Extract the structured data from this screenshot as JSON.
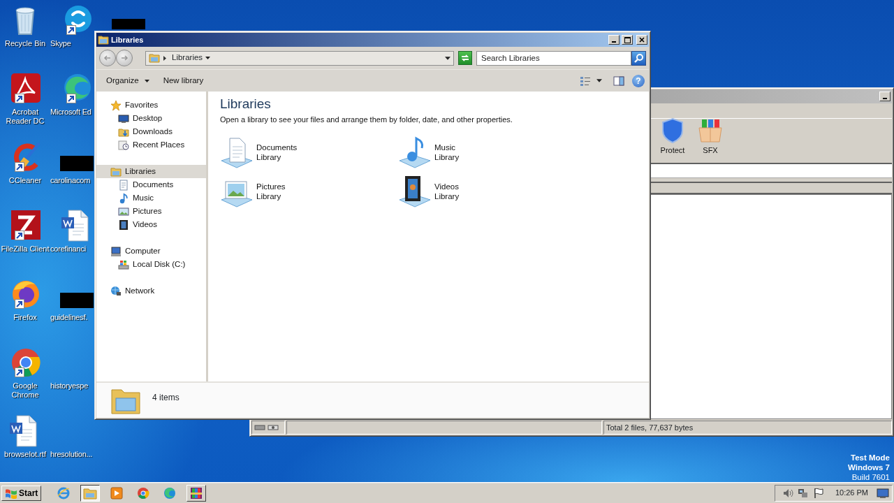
{
  "desktop_icons": [
    {
      "label": "Recycle Bin",
      "kind": "recycle-bin",
      "shortcut": false
    },
    {
      "label": "Acrobat Reader DC",
      "kind": "acrobat",
      "shortcut": true
    },
    {
      "label": "CCleaner",
      "kind": "ccleaner",
      "shortcut": true
    },
    {
      "label": "FileZilla Client",
      "kind": "filezilla",
      "shortcut": true
    },
    {
      "label": "Firefox",
      "kind": "firefox",
      "shortcut": true
    },
    {
      "label": "Google Chrome",
      "kind": "chrome",
      "shortcut": true
    },
    {
      "label": "browselot.rtf",
      "kind": "word-doc",
      "shortcut": false
    },
    {
      "label": "Skype",
      "kind": "skype",
      "shortcut": true
    },
    {
      "label": "Microsoft Ed",
      "kind": "edge",
      "shortcut": true
    },
    {
      "label": "carolinacom",
      "kind": "redacted",
      "shortcut": false
    },
    {
      "label": "corefinanci",
      "kind": "word-doc",
      "shortcut": false
    },
    {
      "label": "guidelinesf.",
      "kind": "redacted",
      "shortcut": false
    },
    {
      "label": "historyespe",
      "kind": "blank"
    },
    {
      "label": "hresolution...",
      "kind": "blank"
    },
    {
      "kind": "redacted",
      "shortcut": false
    }
  ],
  "archive_window": {
    "toolbar": [
      {
        "label": "Protect",
        "kind": "shield"
      },
      {
        "label": "SFX",
        "kind": "box"
      }
    ],
    "status_bar": "Total 2 files, 77,637 bytes"
  },
  "explorer": {
    "title": "Libraries",
    "breadcrumb": [
      "Libraries"
    ],
    "search": {
      "placeholder": "Search Libraries"
    },
    "commands": [
      {
        "label": "Organize",
        "dropdown": true
      },
      {
        "label": "New library",
        "dropdown": false
      }
    ],
    "help_label": "?",
    "nav": [
      {
        "label": "Favorites",
        "kind": "star",
        "selected": false,
        "children": [
          {
            "label": "Desktop",
            "kind": "desktop",
            "selected": false
          },
          {
            "label": "Downloads",
            "kind": "downloads",
            "selected": false
          },
          {
            "label": "Recent Places",
            "kind": "recent",
            "selected": false
          }
        ]
      },
      {
        "label": "Libraries",
        "kind": "library",
        "selected": true,
        "children": [
          {
            "label": "Documents",
            "kind": "document",
            "selected": false
          },
          {
            "label": "Music",
            "kind": "music",
            "selected": false
          },
          {
            "label": "Pictures",
            "kind": "pictures",
            "selected": false
          },
          {
            "label": "Videos",
            "kind": "videos",
            "selected": false
          }
        ]
      },
      {
        "label": "Computer",
        "kind": "computer",
        "selected": false,
        "children": [
          {
            "label": "Local Disk (C:)",
            "kind": "disk",
            "selected": false
          }
        ]
      },
      {
        "label": "Network",
        "kind": "network",
        "selected": false
      }
    ],
    "heading": "Libraries",
    "description": "Open a library to see your files and arrange them by folder, date, and other properties.",
    "items": [
      {
        "name": "Documents",
        "type": "Library",
        "kind": "documents"
      },
      {
        "name": "Music",
        "type": "Library",
        "kind": "music"
      },
      {
        "name": "Pictures",
        "type": "Library",
        "kind": "pictures"
      },
      {
        "name": "Videos",
        "type": "Library",
        "kind": "videos"
      }
    ],
    "details": "4 items"
  },
  "taskbar": {
    "start": "Start",
    "apps": [
      {
        "kind": "ie",
        "running": false,
        "selected": false
      },
      {
        "kind": "explorer",
        "running": true,
        "selected": true
      },
      {
        "kind": "media",
        "running": false,
        "selected": false
      },
      {
        "kind": "chrome",
        "running": false,
        "selected": false
      },
      {
        "kind": "edge",
        "running": false,
        "selected": false
      },
      {
        "kind": "winrar",
        "running": true,
        "selected": false
      }
    ],
    "tray": [
      {
        "kind": "speaker"
      },
      {
        "kind": "network"
      },
      {
        "kind": "flag"
      }
    ],
    "clock": "10:26 PM"
  },
  "os_notice": [
    {
      "text": "Test Mode",
      "bold": true
    },
    {
      "text": "Windows 7",
      "bold": true
    },
    {
      "text": "Build 7601",
      "bold": false
    }
  ]
}
